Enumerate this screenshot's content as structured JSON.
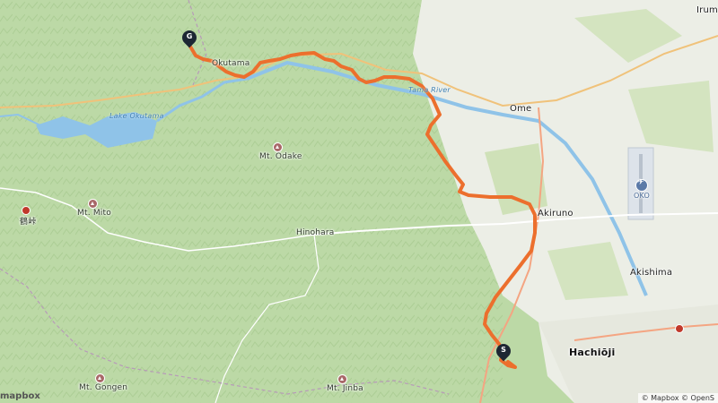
{
  "map": {
    "labels": {
      "okutama": "Okutama",
      "ome": "Ome",
      "irum": "Irum",
      "akiruno": "Akiruno",
      "hinohara": "Hinohara",
      "akishima": "Akishima",
      "hachioji": "Hachiōji",
      "lake": "Lake Okutama",
      "tama_river": "Tama River",
      "mt_odake": "Mt. Odake",
      "mt_mito": "Mt. Mito",
      "mt_gongen": "Mt. Gongen",
      "mt_jinba": "Mt. Jinba",
      "airport_code": "OKO",
      "kanji": "鶴峠"
    },
    "markers": {
      "start": "S",
      "goal": "G"
    },
    "attribution": "© Mapbox © OpenS",
    "logo": "mapbox"
  },
  "colors": {
    "route": "#ec6f2d",
    "terrain": "#bcd9a6",
    "urban": "#eceee6",
    "water": "#8fc3e8",
    "marker": "#1d2733"
  }
}
